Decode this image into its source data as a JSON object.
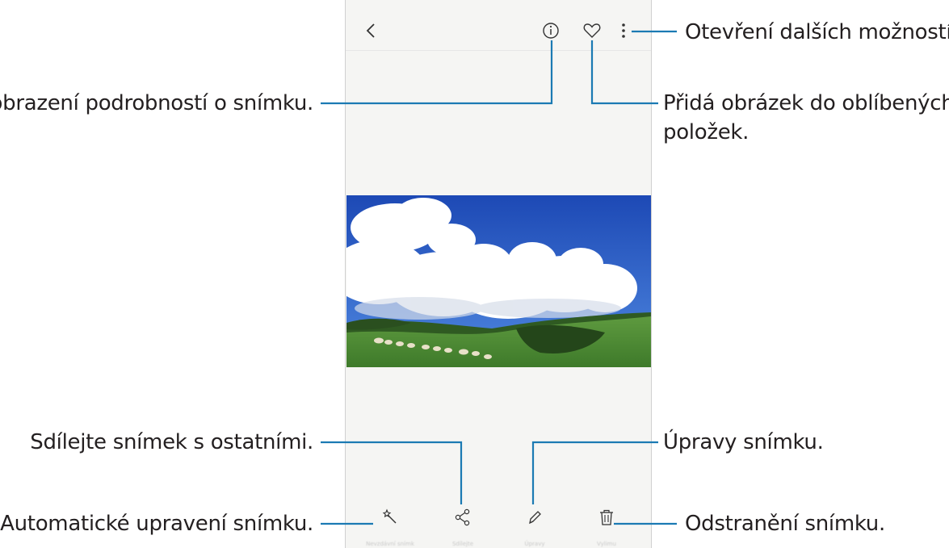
{
  "callouts": {
    "more_options": "Otevření dalších možností.",
    "details": "Zobrazení podrobností o snímku.",
    "favorite_line1": "Přidá obrázek do oblíbených",
    "favorite_line2": "položek.",
    "share": "Sdílejte snímek s ostatními.",
    "edit": "Úpravy snímku.",
    "auto_adjust": "Automatické upravení snímku.",
    "delete": "Odstranění snímku."
  },
  "toolbar": {
    "auto_label": "Nevzdávní snímk",
    "share_label": "Sdílejte",
    "edit_label": "Úpravy",
    "delete_label": "Vylimu"
  },
  "icons": {
    "back": "chevron-left-icon",
    "info": "info-icon",
    "favorite": "heart-icon",
    "more": "more-vertical-icon",
    "auto": "magic-wand-icon",
    "share": "share-icon",
    "edit": "pencil-icon",
    "delete": "trash-icon"
  },
  "colors": {
    "leader": "#1b7ab3",
    "text": "#231f20",
    "sky": "#2f63c9",
    "grass": "#4e8a36"
  }
}
